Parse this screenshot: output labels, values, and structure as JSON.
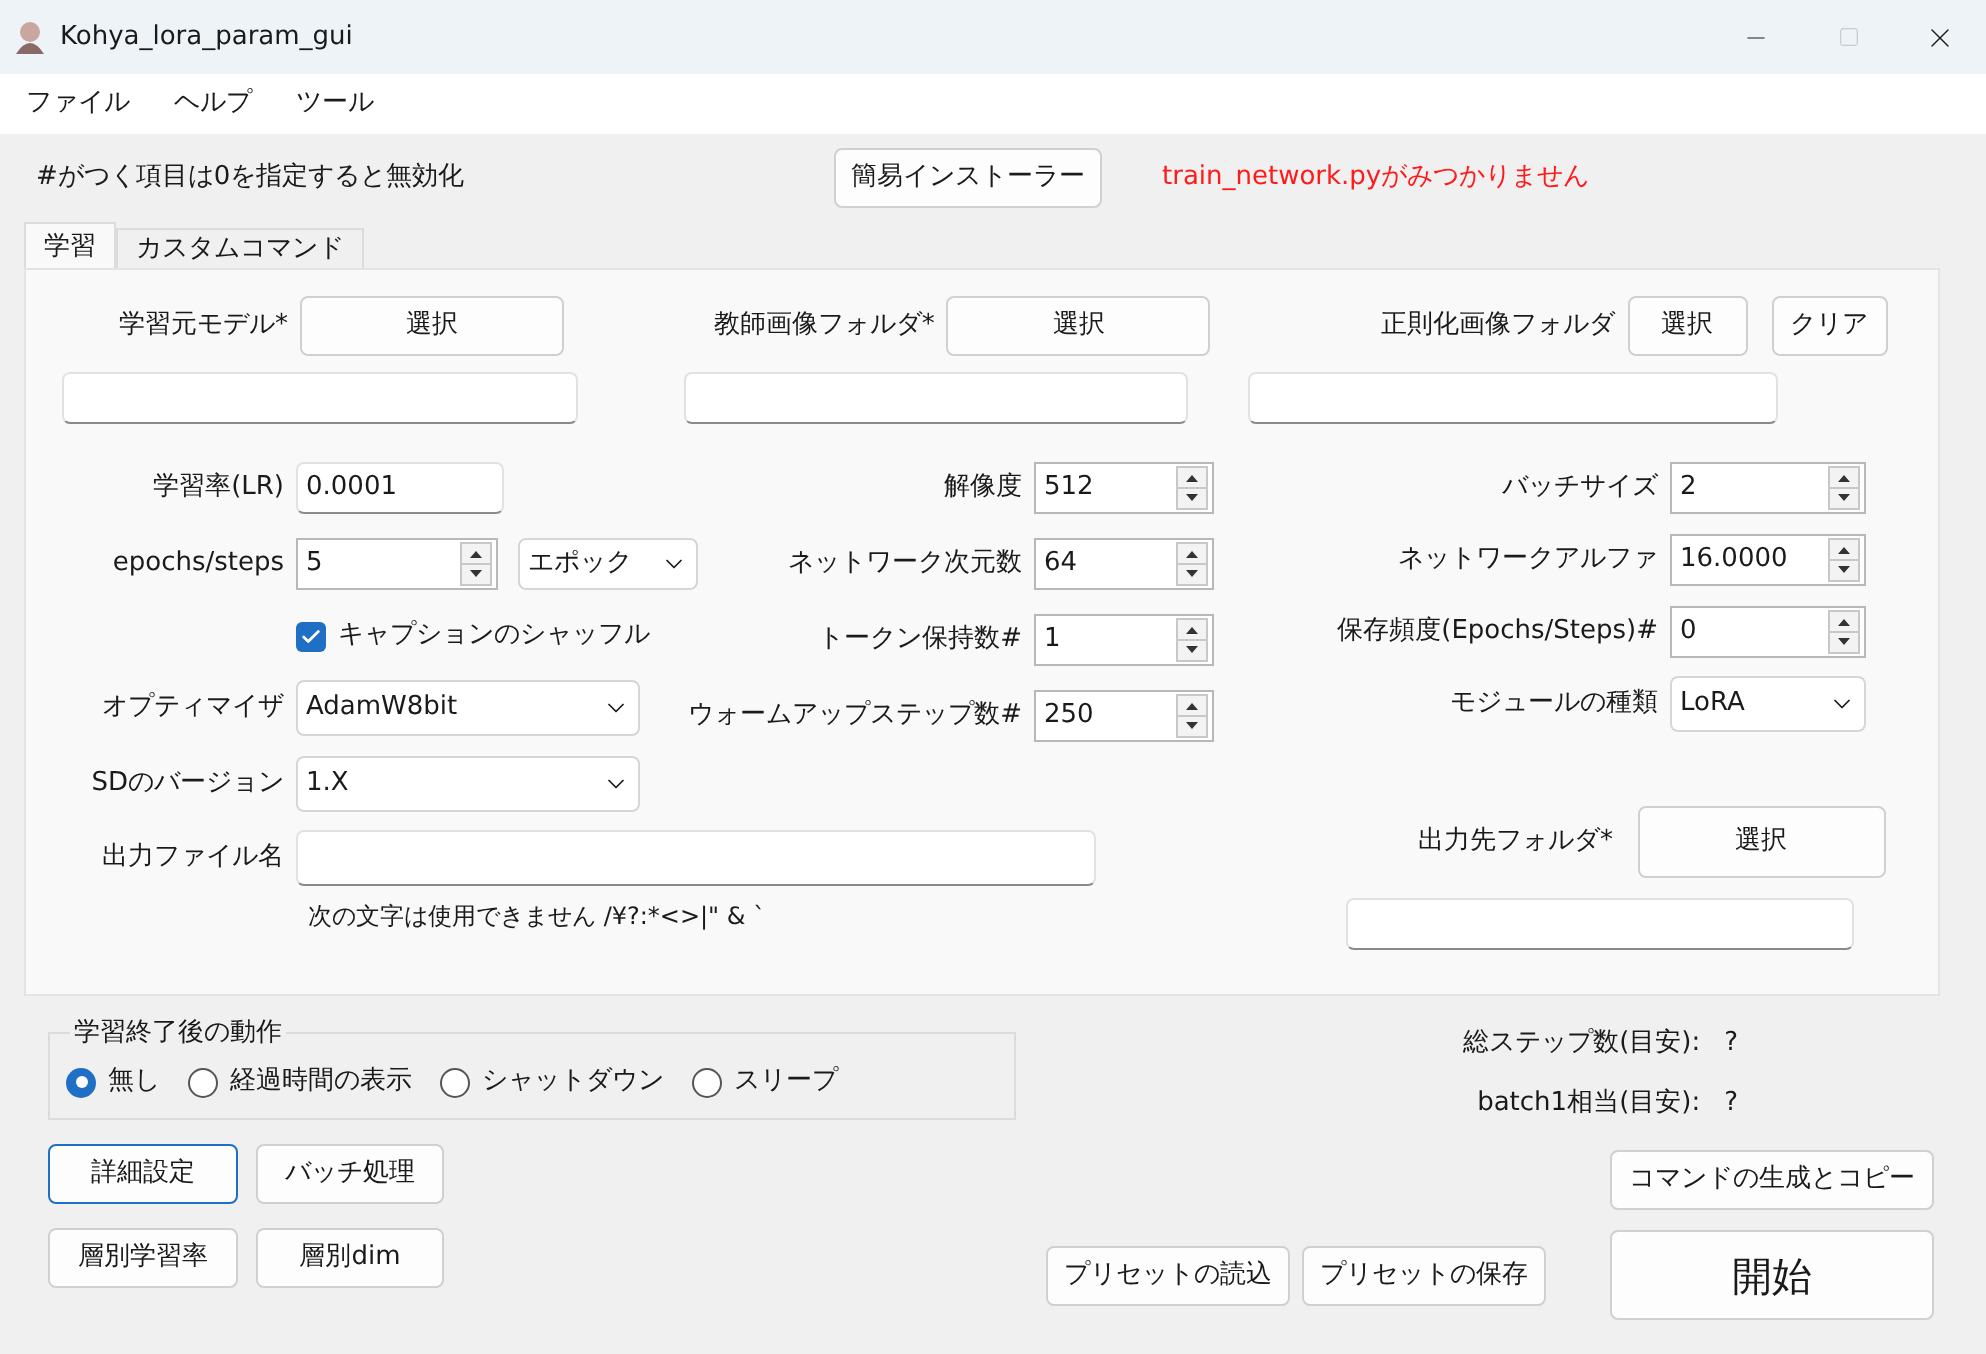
{
  "window": {
    "title": "Kohya_lora_param_gui"
  },
  "menu": [
    "ファイル",
    "ヘルプ",
    "ツール"
  ],
  "note": "#がつく項目は0を指定すると無効化",
  "installer_button": "簡易インストーラー",
  "error": "train_network.pyがみつかりません",
  "tabs": [
    {
      "label": "学習",
      "selected": true
    },
    {
      "label": "カスタムコマンド",
      "selected": false
    }
  ],
  "sources": [
    {
      "label": "学習元モデル*",
      "buttons": [
        "選択"
      ]
    },
    {
      "label": "教師画像フォルダ*",
      "buttons": [
        "選択"
      ]
    },
    {
      "label": "正則化画像フォルダ",
      "buttons": [
        "選択",
        "クリア"
      ]
    }
  ],
  "columns": [
    [
      {
        "kind": "text",
        "label": "学習率(LR)",
        "value": "0.0001"
      },
      {
        "kind": "spin_select",
        "label": "epochs/steps",
        "value": "5",
        "option": "エポック"
      },
      {
        "kind": "checkbox",
        "label": "キャプションのシャッフル",
        "checked": true
      },
      {
        "kind": "select",
        "label": "オプティマイザ",
        "value": "AdamW8bit"
      },
      {
        "kind": "select",
        "label": "SDのバージョン",
        "value": "1.X"
      }
    ],
    [
      {
        "kind": "spin",
        "label": "解像度",
        "value": "512"
      },
      {
        "kind": "spin",
        "label": "ネットワーク次元数",
        "value": "64"
      },
      {
        "kind": "spin",
        "label": "トークン保持数#",
        "value": "1"
      },
      {
        "kind": "spin",
        "label": "ウォームアップステップ数#",
        "value": "250"
      }
    ],
    [
      {
        "kind": "spin",
        "label": "バッチサイズ",
        "value": "2"
      },
      {
        "kind": "spin",
        "label": "ネットワークアルファ",
        "value": "16.0000"
      },
      {
        "kind": "spin",
        "label": "保存頻度(Epochs/Steps)#",
        "value": "0"
      },
      {
        "kind": "select",
        "label": "モジュールの種類",
        "value": "LoRA"
      }
    ]
  ],
  "output_file": {
    "label": "出力ファイル名",
    "hint": "次の文字は使用できません /¥?:*<>|\" & `"
  },
  "output_folder": {
    "label": "出力先フォルダ*",
    "button": "選択"
  },
  "after_training": {
    "title": "学習終了後の動作",
    "options": [
      {
        "label": "無し",
        "selected": true
      },
      {
        "label": "経過時間の表示",
        "selected": false
      },
      {
        "label": "シャットダウン",
        "selected": false
      },
      {
        "label": "スリープ",
        "selected": false
      }
    ]
  },
  "estimates": [
    {
      "label": "総ステップ数(目安):",
      "value": "?"
    },
    {
      "label": "batch1相当(目安):",
      "value": "?"
    }
  ],
  "left_buttons": [
    [
      {
        "label": "詳細設定",
        "focused": true
      },
      {
        "label": "バッチ処理",
        "focused": false
      }
    ],
    [
      {
        "label": "層別学習率",
        "focused": false
      },
      {
        "label": "層別dim",
        "focused": false
      }
    ]
  ],
  "preset_buttons": [
    "プリセットの読込",
    "プリセットの保存"
  ],
  "command_button": "コマンドの生成とコピー",
  "start_button": "開始"
}
